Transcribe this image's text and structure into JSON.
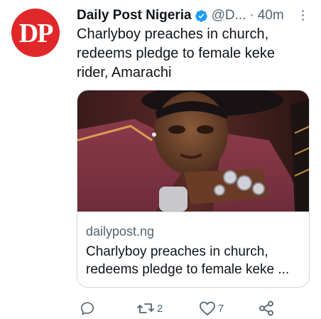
{
  "tweet": {
    "author": {
      "display_name": "Daily Post Nigeria",
      "handle": "@D...",
      "verified": true,
      "avatar_text": "DP",
      "avatar_color": "#e0282b"
    },
    "separator": "·",
    "time": "40m",
    "text": "Charlyboy preaches in church, redeems pledge to female keke rider, Amarachi",
    "card": {
      "domain": "dailypost.ng",
      "title": "Charlyboy preaches in church, redeems pledge to female keke ..."
    },
    "actions": {
      "reply_icon": "reply-icon",
      "retweet_icon": "retweet-icon",
      "retweet_count": "2",
      "like_icon": "heart-icon",
      "like_count": "7",
      "share_icon": "share-icon"
    },
    "colors": {
      "verified_blue": "#1d9bf0",
      "secondary_text": "#536471"
    }
  }
}
